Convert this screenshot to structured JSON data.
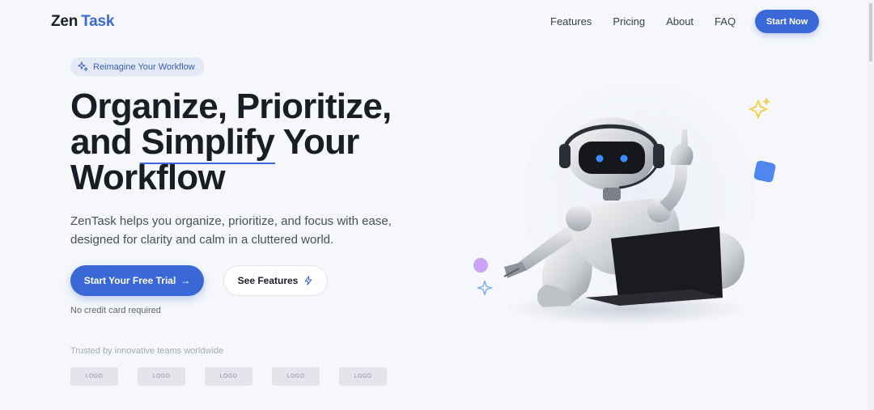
{
  "brand": {
    "first": "Zen",
    "second": "Task"
  },
  "nav": {
    "items": [
      {
        "label": "Features"
      },
      {
        "label": "Pricing"
      },
      {
        "label": "About"
      },
      {
        "label": "FAQ"
      }
    ],
    "cta_label": "Start Now"
  },
  "hero": {
    "badge": "Reimagine Your Workflow",
    "headline_line1": "Organize, Prioritize,",
    "headline_line2_a": "and",
    "headline_highlight": "Simplify",
    "headline_line2_b": "Your",
    "headline_line3": "Workflow",
    "subtitle": "ZenTask helps you organize, prioritize, and focus with ease, designed for clarity and calm in a cluttered world.",
    "primary_cta": "Start Your Free Trial",
    "primary_cta_arrow": "→",
    "secondary_cta": "See Features",
    "note": "No credit card required"
  },
  "trusted": {
    "label": "Trusted by innovative teams worldwide",
    "logos": [
      "LOGO",
      "LOGO",
      "LOGO",
      "LOGO",
      "LOGO"
    ]
  },
  "colors": {
    "accent": "#3a68d6",
    "background": "#f5f7fb",
    "text": "#1a1d24",
    "sparkle_yellow": "#f3cf4a",
    "cube_blue": "#4f86ef",
    "dot_purple": "#c9a3f5"
  },
  "icons": {
    "badge": "sparkles-icon",
    "cta_arrow": "arrow-right-icon",
    "features": "lightning-icon"
  }
}
